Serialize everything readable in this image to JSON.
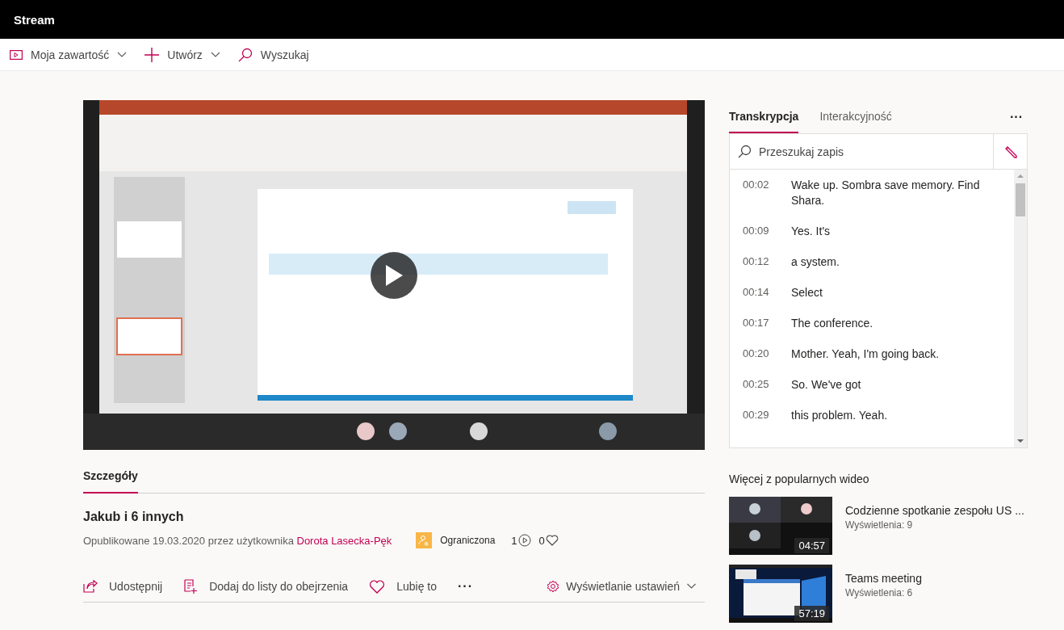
{
  "header": {
    "title": "Stream"
  },
  "nav": [
    {
      "kind": "content",
      "label": "Moja zawartość",
      "dropdown": true
    },
    {
      "kind": "create",
      "label": "Utwórz",
      "dropdown": true
    },
    {
      "kind": "search",
      "label": "Wyszukaj",
      "dropdown": false
    }
  ],
  "details_tabs": [
    {
      "label": "Szczegóły",
      "selected": true
    }
  ],
  "details": {
    "title": "Jakub i 6 innych",
    "published": "Opublikowane 19.03.2020 przez użytkownika ",
    "author": "Dorota Lasecka-Pęk",
    "permission": "Ograniczona",
    "views": "1",
    "likes": "0"
  },
  "actions": [
    {
      "kind": "share",
      "label": "Udostępnij"
    },
    {
      "kind": "watchlist",
      "label": "Dodaj do listy do obejrzenia"
    },
    {
      "kind": "like",
      "label": "Lubię to"
    },
    {
      "kind": "more",
      "label": "···"
    }
  ],
  "view_settings": {
    "label": "Wyświetlanie ustawień"
  },
  "side_tabs": [
    {
      "label": "Transkrypcja",
      "selected": true
    },
    {
      "label": "Interakcyjność",
      "selected": false
    }
  ],
  "side_more": "···",
  "transcript_search": {
    "placeholder": "Przeszukaj zapis"
  },
  "transcript": [
    {
      "time": "00:02",
      "text": "Wake up. Sombra save memory. Find Shara."
    },
    {
      "time": "00:09",
      "text": "Yes. It's"
    },
    {
      "time": "00:12",
      "text": "a system."
    },
    {
      "time": "00:14",
      "text": "Select"
    },
    {
      "time": "00:17",
      "text": "The conference."
    },
    {
      "time": "00:20",
      "text": "Mother. Yeah, I'm going back."
    },
    {
      "time": "00:25",
      "text": "So. We've got"
    },
    {
      "time": "00:29",
      "text": "this problem. Yeah."
    }
  ],
  "popular": {
    "heading": "Więcej z popularnych wideo",
    "videos": [
      {
        "kind": "grid",
        "title": "Codzienne spotkanie zespołu US ...",
        "views": "Wyświetlenia: 9",
        "duration": "04:57"
      },
      {
        "kind": "desktop",
        "title": "Teams meeting",
        "views": "Wyświetlenia: 6",
        "duration": "57:19"
      }
    ]
  }
}
